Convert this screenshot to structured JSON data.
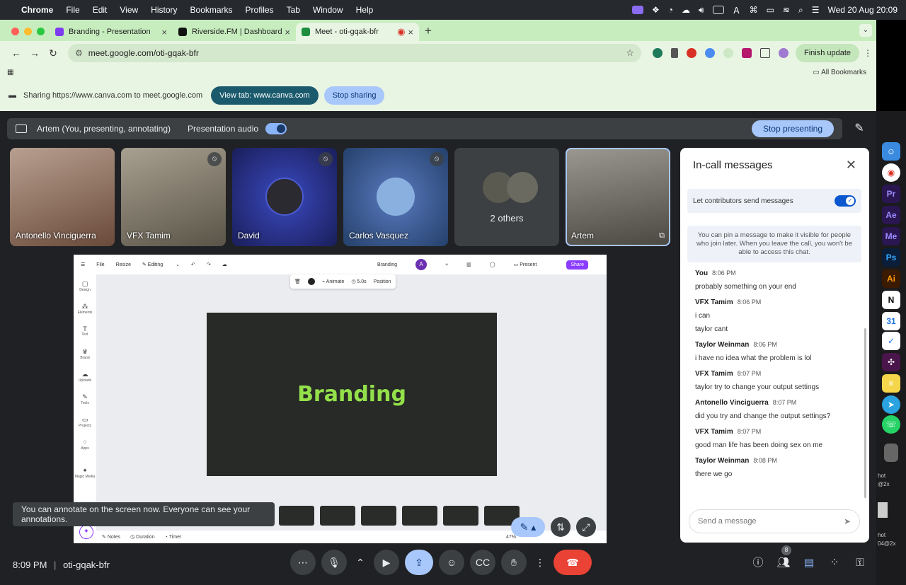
{
  "menubar": {
    "app": "Chrome",
    "items": [
      "File",
      "Edit",
      "View",
      "History",
      "Bookmarks",
      "Profiles",
      "Tab",
      "Window",
      "Help"
    ],
    "datetime": "Wed 20 Aug  20:09"
  },
  "browser": {
    "tabs": [
      {
        "title": "Branding - Presentation",
        "color": "#7d3cf0"
      },
      {
        "title": "Riverside.FM | Dashboard",
        "color": "#111111"
      },
      {
        "title": "Meet - oti-gqak-bfr",
        "color": "#1e8e3e"
      }
    ],
    "url": "meet.google.com/oti-gqak-bfr",
    "finish_update": "Finish update",
    "all_bookmarks": "All Bookmarks"
  },
  "sharing": {
    "text": "Sharing https://www.canva.com to meet.google.com",
    "view_tab": "View tab: www.canva.com",
    "stop_sharing": "Stop sharing"
  },
  "presenting": {
    "label": "Artem (You, presenting, annotating)",
    "audio": "Presentation audio",
    "stop": "Stop presenting"
  },
  "participants": [
    {
      "name": "Antonello Vinciguerra",
      "bg": "#8a6a5a"
    },
    {
      "name": "VFX Tamim",
      "bg": "#7a7368"
    },
    {
      "name": "David",
      "bg": "#2a3a8a"
    },
    {
      "name": "Carlos Vasquez",
      "bg": "#3a5a8a"
    },
    {
      "name": "2 others",
      "bg": "#3c4043"
    },
    {
      "name": "Artem",
      "bg": "#6a6a64"
    }
  ],
  "canva": {
    "menu": [
      "File",
      "Resize",
      "Editing"
    ],
    "doc_name": "Branding",
    "avatar": "A",
    "present": "Present",
    "share": "Share",
    "sidebar": [
      "Design",
      "Elements",
      "Text",
      "Brand",
      "Uploads",
      "Tools",
      "Projects",
      "Apps",
      "Magic Media"
    ],
    "floatbar": [
      "Animate",
      "5.0s",
      "Position"
    ],
    "slide_title": "Branding",
    "bottom": [
      "Notes",
      "Duration",
      "Timer"
    ],
    "zoom": "47%"
  },
  "toast": "You can annotate on the screen now. Everyone can see your annotations.",
  "chat": {
    "title": "In-call messages",
    "contributors": "Let contributors send messages",
    "pin_note": "You can pin a message to make it visible for people who join later. When you leave the call, you won't be able to access this chat.",
    "messages": [
      {
        "sender": "You",
        "time": "8:06 PM",
        "lines": [
          "probably something on your end"
        ]
      },
      {
        "sender": "VFX Tamim",
        "time": "8:06 PM",
        "lines": [
          "i can",
          "taylor cant"
        ]
      },
      {
        "sender": "Taylor Weinman",
        "time": "8:06 PM",
        "lines": [
          "i have no idea what the problem is lol"
        ]
      },
      {
        "sender": "VFX Tamim",
        "time": "8:07 PM",
        "lines": [
          "taylor try to change your output settings"
        ]
      },
      {
        "sender": "Antonello Vinciguerra",
        "time": "8:07 PM",
        "lines": [
          "did you try and change the output settings?"
        ]
      },
      {
        "sender": "VFX Tamim",
        "time": "8:07 PM",
        "lines": [
          "good man life has been doing sex on me"
        ]
      },
      {
        "sender": "Taylor Weinman",
        "time": "8:08 PM",
        "lines": [
          "there we go"
        ]
      }
    ],
    "placeholder": "Send a message"
  },
  "footer": {
    "time": "8:09 PM",
    "meeting_code": "oti-gqak-bfr",
    "people_count": "8"
  },
  "dock": [
    {
      "label": "Pr",
      "bg": "#2a1650",
      "fg": "#9a8cff"
    },
    {
      "label": "Ae",
      "bg": "#2a1650",
      "fg": "#9a8cff"
    },
    {
      "label": "Me",
      "bg": "#2a1650",
      "fg": "#9a8cff"
    },
    {
      "label": "Ps",
      "bg": "#0a1e3a",
      "fg": "#31a8ff"
    },
    {
      "label": "Ai",
      "bg": "#3a1a00",
      "fg": "#ff9a00"
    },
    {
      "label": "N",
      "bg": "#ffffff",
      "fg": "#000000"
    },
    {
      "label": "31",
      "bg": "#ffffff",
      "fg": "#1a73e8"
    }
  ],
  "dock_texts": [
    "hot",
    "@2x",
    "hot",
    "04@2x"
  ]
}
